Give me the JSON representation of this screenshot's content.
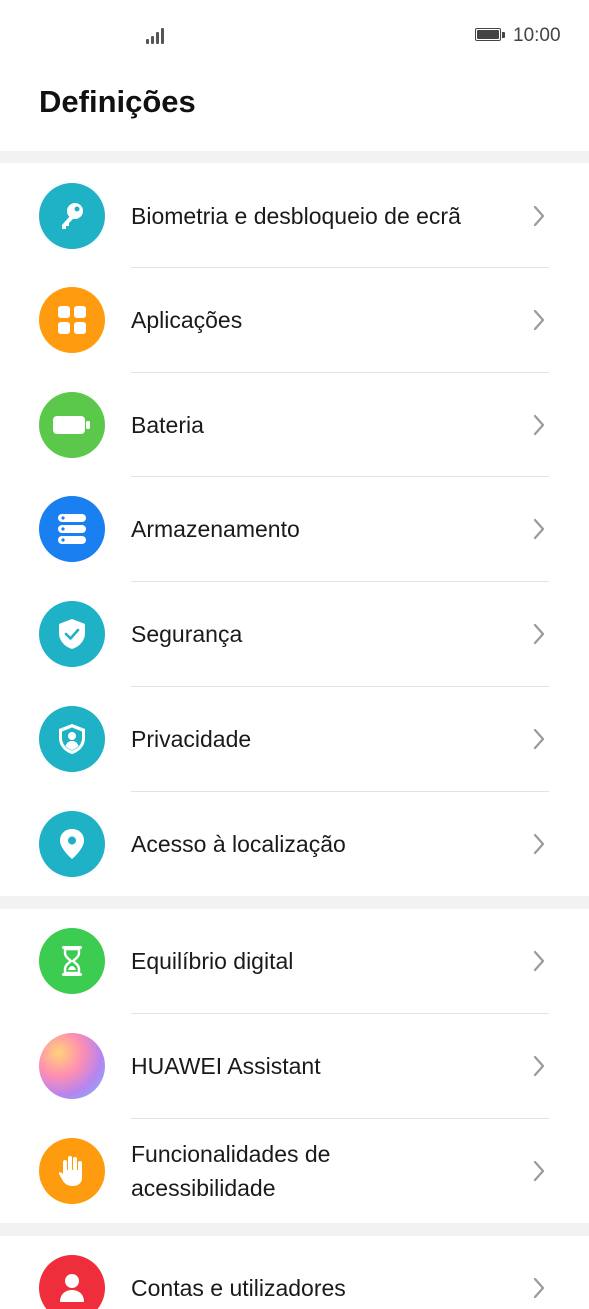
{
  "status_bar": {
    "time": "10:00"
  },
  "page": {
    "title": "Definições"
  },
  "colors": {
    "teal": "#1fb2c7",
    "orange": "#ff9b0f",
    "green": "#5cc84b",
    "blue": "#1a7ff0",
    "green_bright": "#3dcc52",
    "red": "#ee2f3b",
    "divider": "#e3e3e3",
    "section_gap": "#f2f2f2"
  },
  "settings": [
    {
      "label": "Biometria e desbloqueio de ecrã",
      "icon": "key-icon"
    },
    {
      "label": "Aplicações",
      "icon": "apps-grid-icon"
    },
    {
      "label": "Bateria",
      "icon": "battery-icon"
    },
    {
      "label": "Armazenamento",
      "icon": "storage-icon"
    },
    {
      "label": "Segurança",
      "icon": "shield-check-icon"
    },
    {
      "label": "Privacidade",
      "icon": "privacy-shield-icon"
    },
    {
      "label": "Acesso à localização",
      "icon": "location-pin-icon"
    },
    {
      "label": "Equilíbrio digital",
      "icon": "hourglass-icon"
    },
    {
      "label": "HUAWEI Assistant",
      "icon": "huawei-assistant-icon"
    },
    {
      "label_line1": "Funcionalidades de",
      "label_line2": "acessibilidade",
      "icon": "hand-icon"
    },
    {
      "label": "Contas e utilizadores",
      "icon": "account-icon"
    }
  ]
}
